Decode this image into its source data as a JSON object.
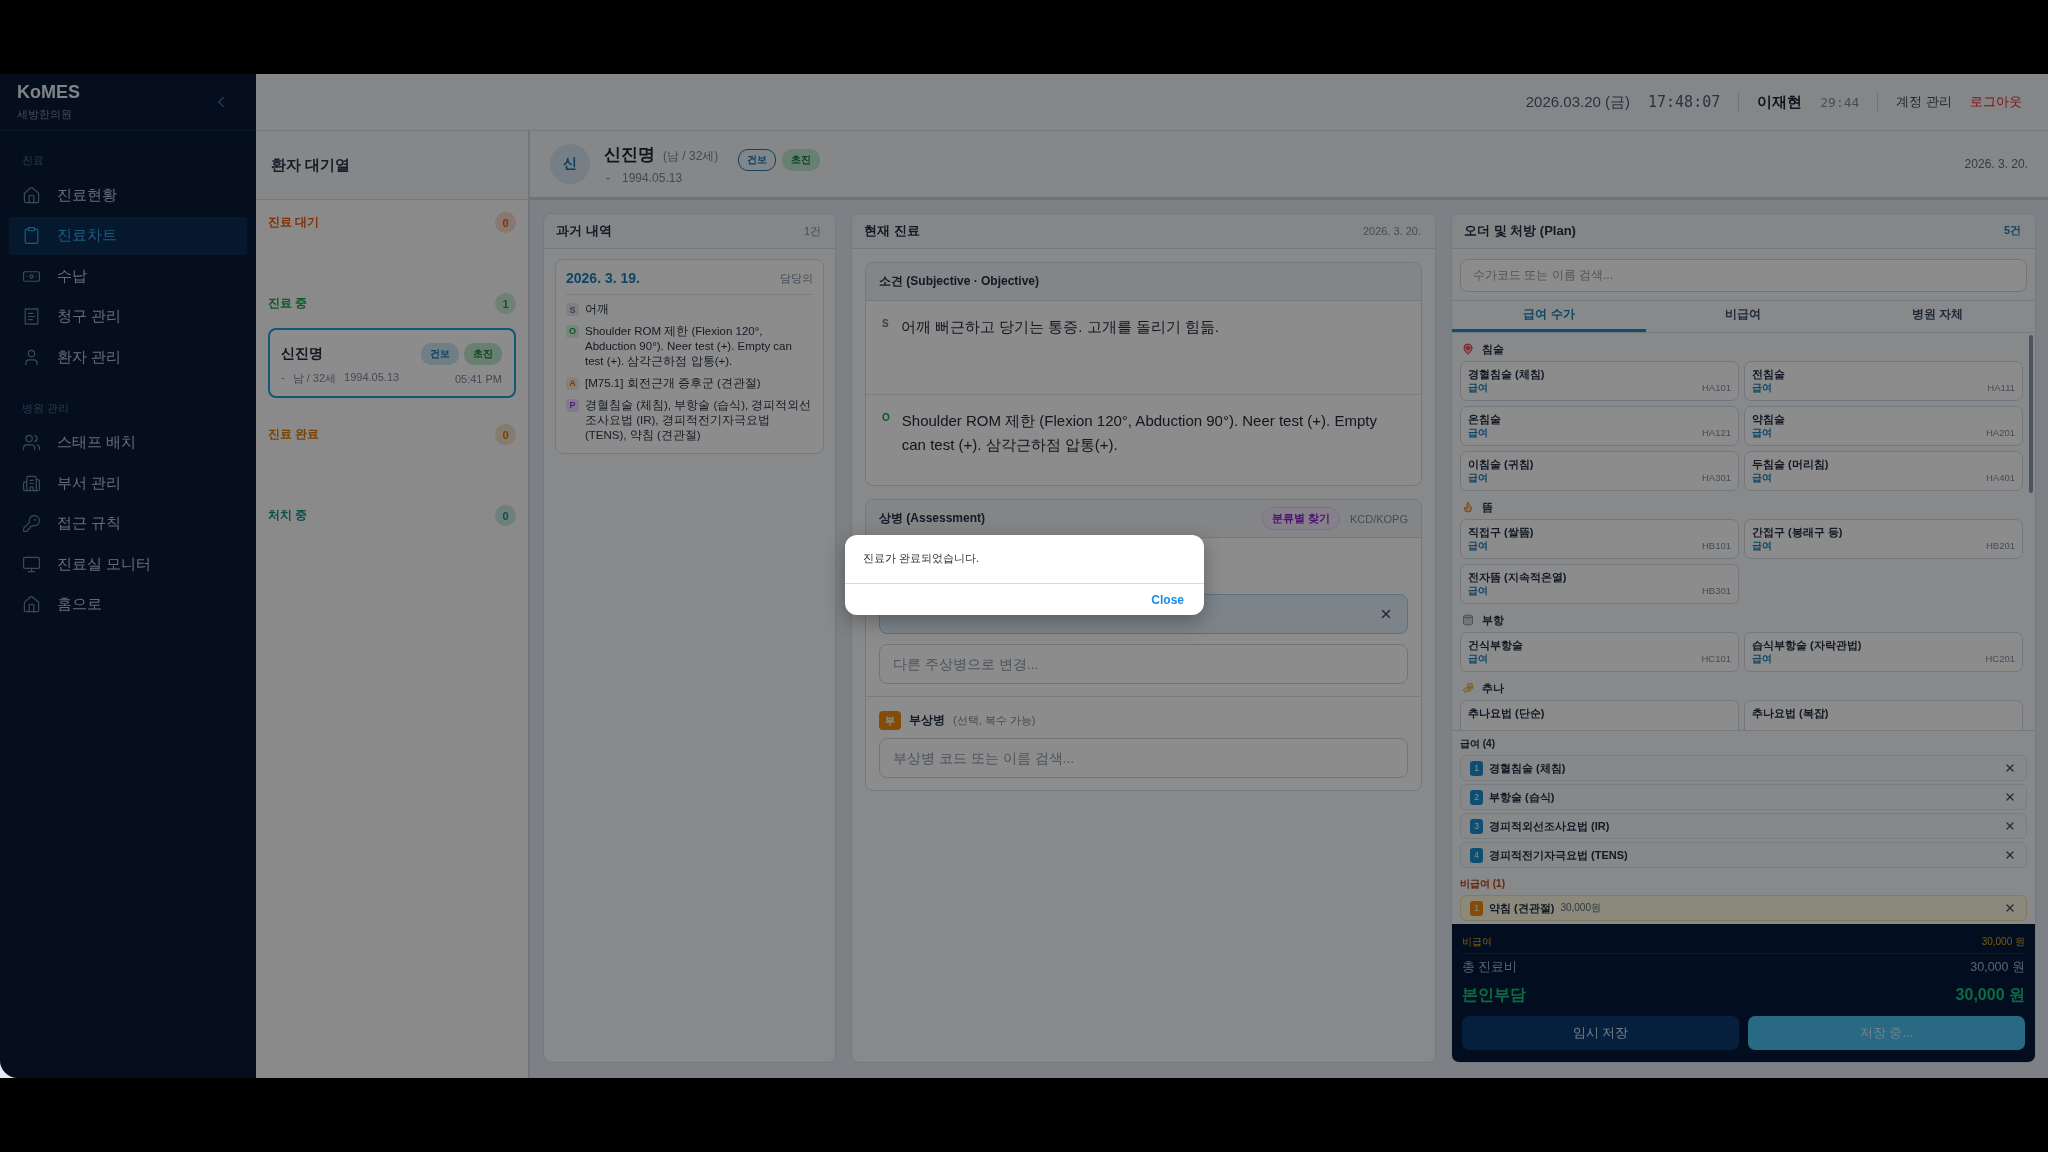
{
  "sidebar": {
    "logo": "KoMES",
    "clinic": "세방한의원",
    "sections": [
      {
        "title": "진료",
        "items": [
          {
            "label": "진료현황",
            "selected": false
          },
          {
            "label": "진료차트",
            "selected": true
          },
          {
            "label": "수납",
            "selected": false
          },
          {
            "label": "청구 관리",
            "selected": false
          },
          {
            "label": "환자 관리",
            "selected": false
          }
        ]
      },
      {
        "title": "병원 관리",
        "items": [
          {
            "label": "스태프 배치",
            "selected": false
          },
          {
            "label": "부서 관리",
            "selected": false
          },
          {
            "label": "접근 규칙",
            "selected": false
          },
          {
            "label": "진료실 모니터",
            "selected": false
          },
          {
            "label": "홈으로",
            "selected": false
          }
        ]
      }
    ]
  },
  "topbar": {
    "date": "2026.03.20 (금)",
    "time": "17:48:07",
    "user": "이재현",
    "session": "29:44",
    "links": [
      {
        "label": "계정 관리",
        "kind": "normal"
      },
      {
        "label": "로그아웃",
        "kind": "danger"
      }
    ]
  },
  "queue": {
    "title": "환자 대기열",
    "groups": [
      {
        "title": "진료 대기",
        "count": "0",
        "kind": "waiting"
      },
      {
        "title": "진료 중",
        "count": "1",
        "kind": "in_progress",
        "patients": [
          {
            "name": "신진명",
            "tags": [
              {
                "label": "건보",
                "kind": "insurance"
              },
              {
                "label": "초진",
                "kind": "visit"
              }
            ],
            "dash": "-",
            "sex_age": "남 / 32세",
            "birth": "1994.05.13",
            "time": "05:41 PM",
            "selected": true
          }
        ]
      },
      {
        "title": "진료 완료",
        "count": "0",
        "kind": "done"
      },
      {
        "title": "처치 중",
        "count": "0",
        "kind": "treatment"
      }
    ]
  },
  "patient": {
    "avatar": "신",
    "name": "신진명",
    "sex_age": "(남 / 32세)",
    "dash": "-",
    "birth": "1994.05.13",
    "tags": [
      {
        "label": "건보",
        "kind": "insurance"
      },
      {
        "label": "초진",
        "kind": "visit"
      }
    ],
    "date": "2026. 3. 20."
  },
  "history": {
    "title": "과거 내역",
    "count": "1건",
    "visits": [
      {
        "date": "2026. 3. 19.",
        "doctor": "담당의",
        "entries": [
          {
            "letter": "S",
            "kind": "subjective",
            "text": "어깨"
          },
          {
            "letter": "O",
            "kind": "objective",
            "text": "Shoulder ROM 제한 (Flexion 120°, Abduction 90°). Neer test (+). Empty can test (+). 삼각근하점 압통(+)."
          },
          {
            "letter": "A",
            "kind": "assessment",
            "text": "[M75.1] 회전근개 증후군 (견관절)"
          },
          {
            "letter": "P",
            "kind": "plan",
            "text": "경혈침술 (체침), 부항술 (습식), 경피적외선조사요법 (IR), 경피적전기자극요법 (TENS), 약침 (견관절)"
          }
        ]
      }
    ]
  },
  "current": {
    "title": "현재 진료",
    "date": "2026. 3. 20.",
    "so": {
      "title": "소견 (Subjective · Objective)",
      "entries": [
        {
          "letter": "S",
          "kind": "subjective",
          "text": "어깨 뻐근하고 당기는 통증. 고개를 돌리기 힘듦."
        },
        {
          "letter": "O",
          "kind": "objective",
          "text": "Shoulder ROM 제한 (Flexion 120°, Abduction 90°). Neer test (+). Empty can test (+). 삼각근하점 압통(+)."
        }
      ]
    },
    "assessment": {
      "title": "상병 (Assessment)",
      "find_button": "분류별 찾기",
      "code_system": "KCD/KOPG",
      "main_change_placeholder": "다른 주상병으로 변경...",
      "sub": {
        "badge": "부",
        "title": "부상병",
        "hint": "(선택, 복수 가능)",
        "placeholder": "부상병 코드 또는 이름 검색..."
      }
    }
  },
  "plan": {
    "title": "오더 및 처방 (Plan)",
    "count": "5건",
    "search_placeholder": "수가코드 또는 이름 검색...",
    "tabs": [
      {
        "label": "급여 수가",
        "selected": true
      },
      {
        "label": "비급여",
        "selected": false
      },
      {
        "label": "병원 자체",
        "selected": false
      }
    ],
    "categories": [
      {
        "title": "침술",
        "items": [
          {
            "name": "경혈침술 (체침)",
            "coverage": "급여",
            "code": "HA101"
          },
          {
            "name": "전침술",
            "coverage": "급여",
            "code": "HA111"
          },
          {
            "name": "온침술",
            "coverage": "급여",
            "code": "HA121"
          },
          {
            "name": "약침술",
            "coverage": "급여",
            "code": "HA201"
          },
          {
            "name": "이침술 (귀침)",
            "coverage": "급여",
            "code": "HA301"
          },
          {
            "name": "두침술 (머리침)",
            "coverage": "급여",
            "code": "HA401"
          }
        ]
      },
      {
        "title": "뜸",
        "items": [
          {
            "name": "직접구 (쌀뜸)",
            "coverage": "급여",
            "code": "HB101"
          },
          {
            "name": "간접구 (봉래구 등)",
            "coverage": "급여",
            "code": "HB201"
          },
          {
            "name": "전자뜸 (지속적온열)",
            "coverage": "급여",
            "code": "HB301"
          }
        ]
      },
      {
        "title": "부항",
        "items": [
          {
            "name": "건식부항술",
            "coverage": "급여",
            "code": "HC101"
          },
          {
            "name": "습식부항술 (자락관법)",
            "coverage": "급여",
            "code": "HC201"
          }
        ]
      },
      {
        "title": "추나",
        "items": [
          {
            "name": "추나요법 (단순)"
          },
          {
            "name": "추나요법 (복잡)"
          }
        ]
      }
    ],
    "orders": [
      {
        "title": "급여 (4)",
        "kind": "covered",
        "items": [
          {
            "number": "1",
            "name": "경혈침술 (체침)"
          },
          {
            "number": "2",
            "name": "부항술 (습식)"
          },
          {
            "number": "3",
            "name": "경피적외선조사요법 (IR)"
          },
          {
            "number": "4",
            "name": "경피적전기자극요법 (TENS)"
          }
        ]
      },
      {
        "title": "비급여 (1)",
        "kind": "noncovered",
        "items": [
          {
            "number": "1",
            "name": "약침 (견관절)",
            "price": "30,000원"
          }
        ]
      }
    ],
    "summary": [
      {
        "label": "비급여",
        "value": "30,000 원",
        "kind": "noncovered"
      },
      {
        "label": "총 진료비",
        "value": "30,000 원",
        "kind": "total"
      },
      {
        "label": "본인부담",
        "value": "30,000 원",
        "kind": "patient"
      }
    ],
    "buttons": [
      {
        "label": "임시 저장",
        "kind": "secondary"
      },
      {
        "label": "저장 중...",
        "kind": "primary"
      }
    ]
  },
  "dialog": {
    "message": "진료가 완료되었습니다.",
    "button": "Close"
  }
}
